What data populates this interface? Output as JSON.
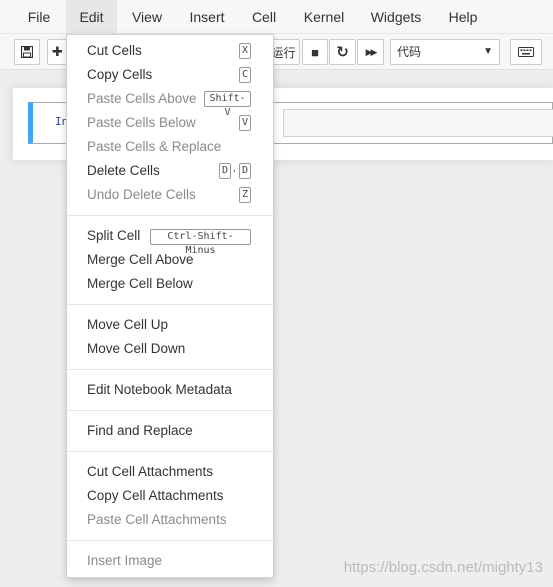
{
  "menubar": {
    "items": [
      {
        "label": "File"
      },
      {
        "label": "Edit"
      },
      {
        "label": "View"
      },
      {
        "label": "Insert"
      },
      {
        "label": "Cell"
      },
      {
        "label": "Kernel"
      },
      {
        "label": "Widgets"
      },
      {
        "label": "Help"
      }
    ]
  },
  "toolbar": {
    "run_label": "运行",
    "cell_type": "代码",
    "plus": "✚",
    "stop": "■",
    "restart": "↻",
    "fastforward": "▶▶"
  },
  "cell": {
    "prompt": "In"
  },
  "edit_menu": {
    "items": [
      {
        "label": "Cut Cells",
        "shortcut": [
          "X"
        ],
        "enabled": true
      },
      {
        "label": "Copy Cells",
        "shortcut": [
          "C"
        ],
        "enabled": true
      },
      {
        "label": "Paste Cells Above",
        "shortcut": [
          "Shift-V"
        ],
        "enabled": false
      },
      {
        "label": "Paste Cells Below",
        "shortcut": [
          "V"
        ],
        "enabled": false
      },
      {
        "label": "Paste Cells & Replace",
        "shortcut": [],
        "enabled": false
      },
      {
        "label": "Delete Cells",
        "shortcut": [
          "D",
          "D"
        ],
        "enabled": true
      },
      {
        "label": "Undo Delete Cells",
        "shortcut": [
          "Z"
        ],
        "enabled": false
      },
      {
        "label": "Split Cell",
        "shortcut": [
          "Ctrl-Shift-Minus"
        ],
        "enabled": true
      },
      {
        "label": "Merge Cell Above",
        "shortcut": [],
        "enabled": true
      },
      {
        "label": "Merge Cell Below",
        "shortcut": [],
        "enabled": true
      },
      {
        "label": "Move Cell Up",
        "shortcut": [],
        "enabled": true
      },
      {
        "label": "Move Cell Down",
        "shortcut": [],
        "enabled": true
      },
      {
        "label": "Edit Notebook Metadata",
        "shortcut": [],
        "enabled": true
      },
      {
        "label": "Find and Replace",
        "shortcut": [],
        "enabled": true
      },
      {
        "label": "Cut Cell Attachments",
        "shortcut": [],
        "enabled": true
      },
      {
        "label": "Copy Cell Attachments",
        "shortcut": [],
        "enabled": true
      },
      {
        "label": "Paste Cell Attachments",
        "shortcut": [],
        "enabled": false
      },
      {
        "label": "Insert Image",
        "shortcut": [],
        "enabled": false
      }
    ]
  },
  "watermark": "https://blog.csdn.net/mighty13"
}
